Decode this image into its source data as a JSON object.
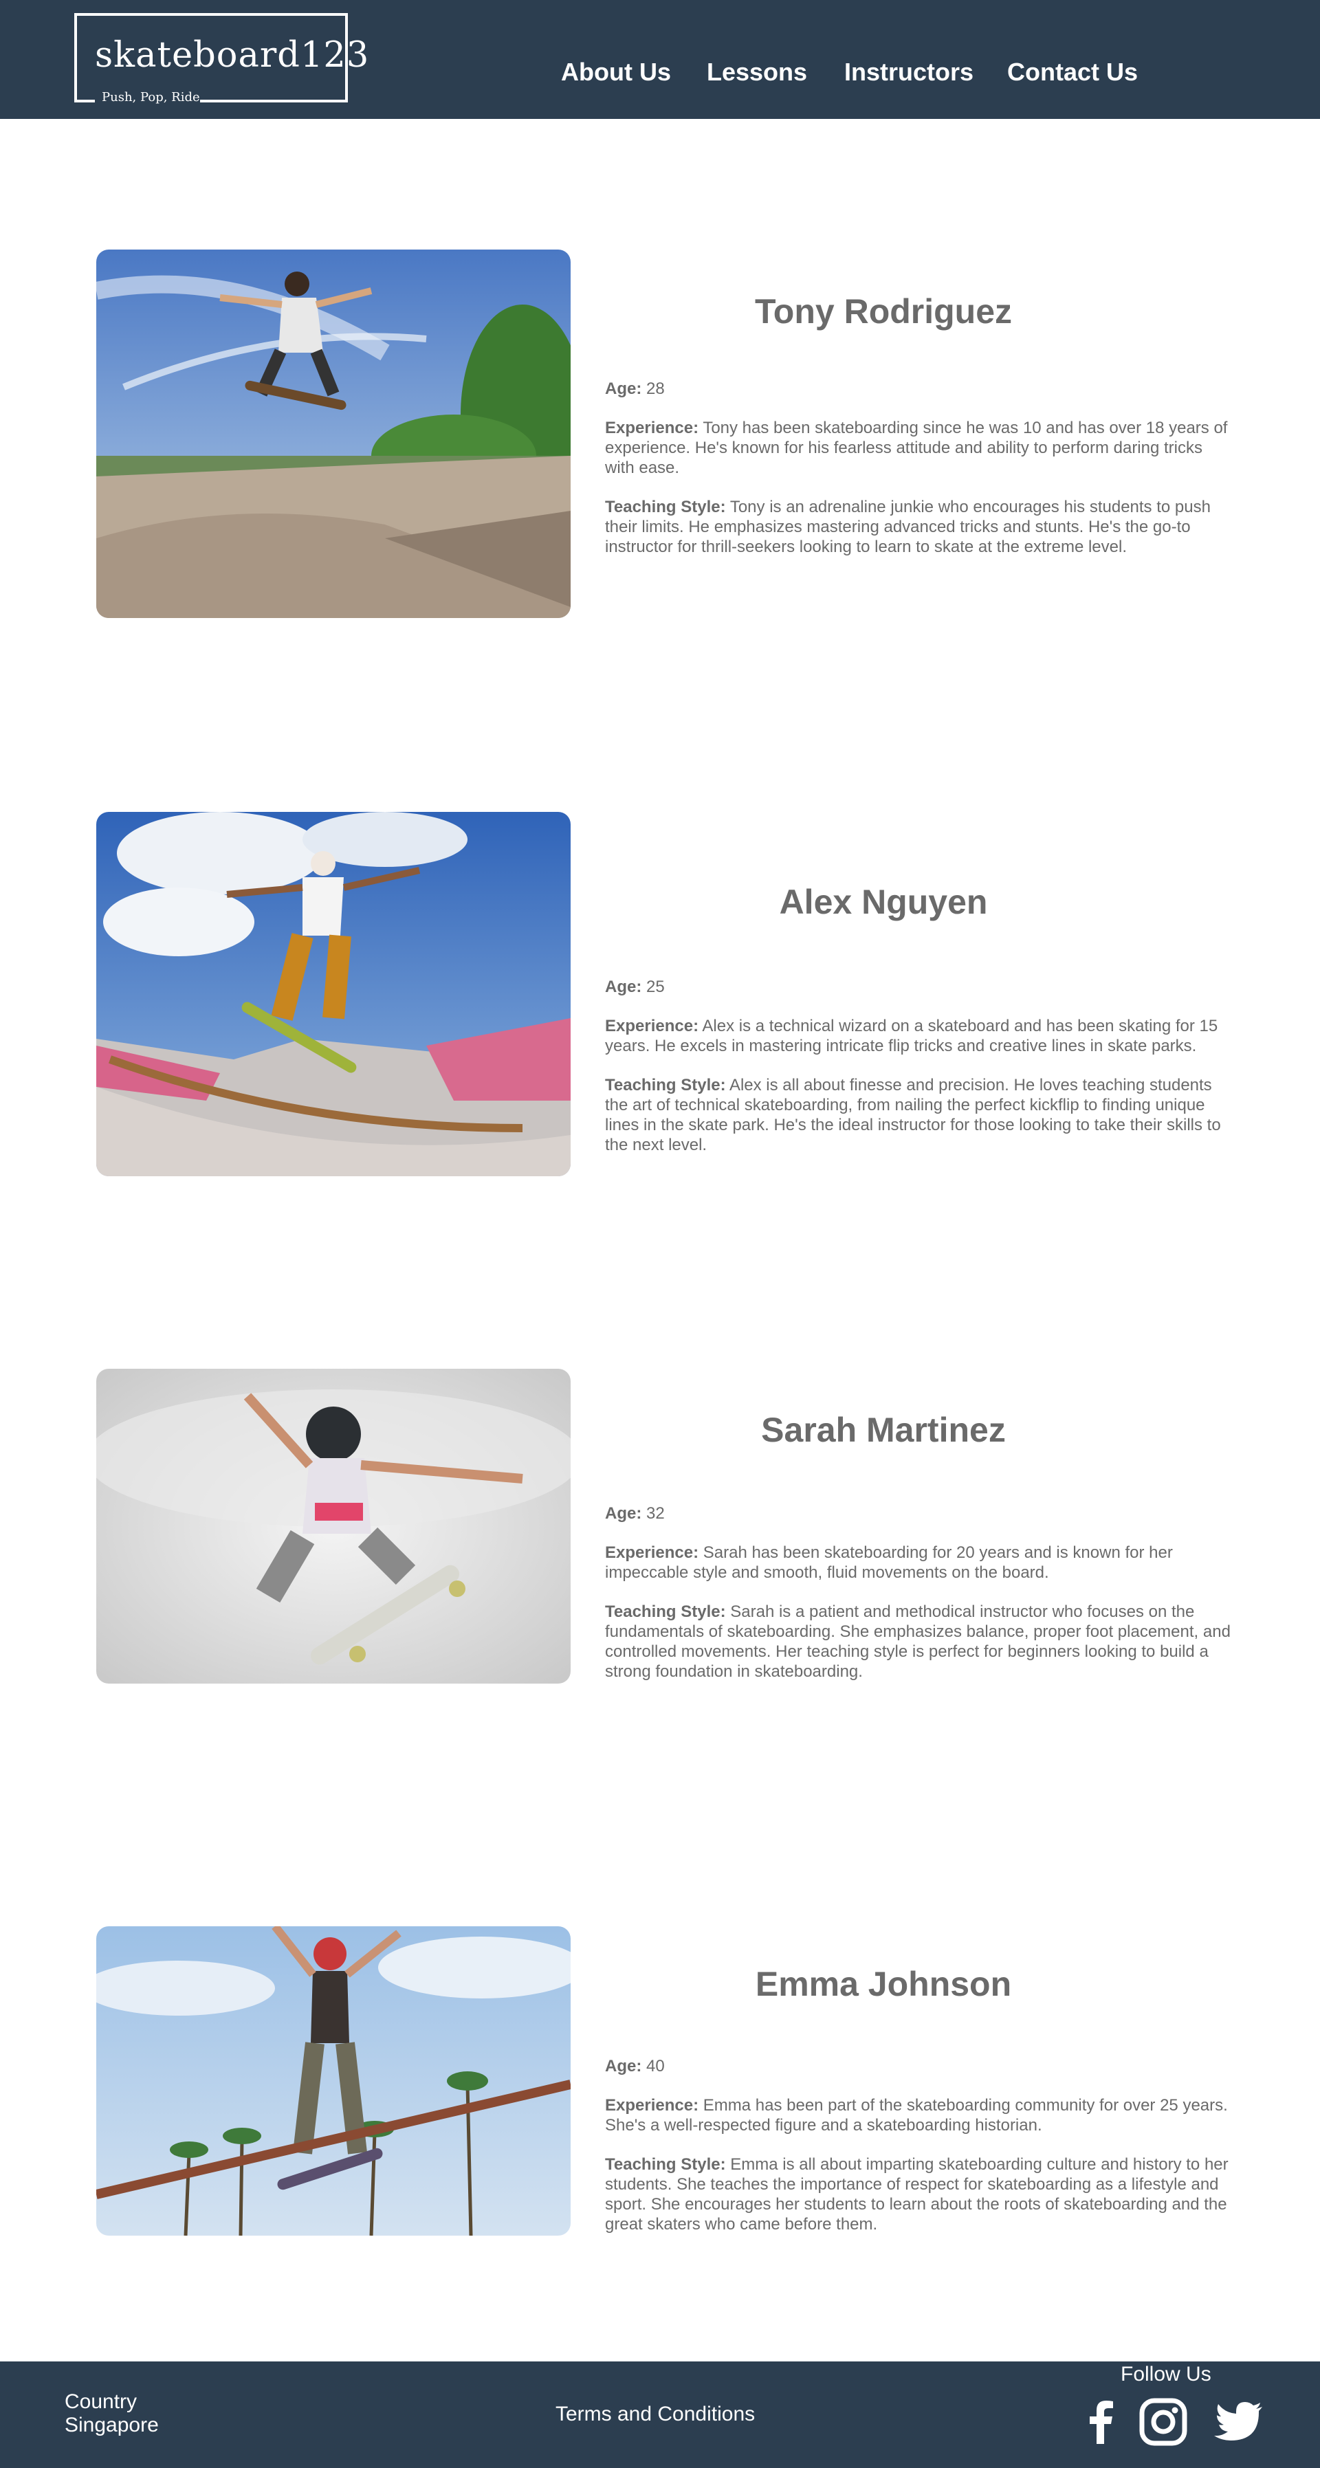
{
  "header": {
    "logo_name": "skateboard123",
    "logo_tagline": "Push, Pop, Ride",
    "nav": [
      "About Us",
      "Lessons",
      "Instructors",
      "Contact Us"
    ]
  },
  "labels": {
    "age": "Age:",
    "experience": "Experience:",
    "teaching_style": "Teaching Style:"
  },
  "instructors": [
    {
      "name": "Tony Rodriguez",
      "age": "28",
      "experience": "Tony has been skateboarding since he was 10 and has over 18 years of experience. He's known for his fearless attitude and ability to perform daring tricks with ease.",
      "teaching_style": "Tony is an adrenaline junkie who encourages his students to push their limits. He emphasizes mastering advanced tricks and stunts. He's the go-to instructor for thrill-seekers looking to learn to skate at the extreme level."
    },
    {
      "name": "Alex Nguyen",
      "age": "25",
      "experience": "Alex is a technical wizard on a skateboard and has been skating for 15 years. He excels in mastering intricate flip tricks and creative lines in skate parks.",
      "teaching_style": "Alex is all about finesse and precision. He loves teaching students the art of technical skateboarding, from nailing the perfect kickflip to finding unique lines in the skate park. He's the ideal instructor for those looking to take their skills to the next level."
    },
    {
      "name": "Sarah Martinez",
      "age": "32",
      "experience": "Sarah has been skateboarding for 20 years and is known for her impeccable style and smooth, fluid movements on the board.",
      "teaching_style": "Sarah is a patient and methodical instructor who focuses on the fundamentals of skateboarding. She emphasizes balance, proper foot placement, and controlled movements. Her teaching style is perfect for beginners looking to build a strong foundation in skateboarding."
    },
    {
      "name": "Emma Johnson",
      "age": "40",
      "experience": "Emma has been part of the skateboarding community for over 25 years. She's a well-respected figure and a skateboarding historian.",
      "teaching_style": "Emma is all about imparting skateboarding culture and history to her students. She teaches the importance of respect for skateboarding as a lifestyle and sport. She encourages her students to learn about the roots of skateboarding and the great skaters who came before them."
    }
  ],
  "footer": {
    "address_line1": "Country",
    "address_line2": "Singapore",
    "terms": "Terms and Conditions",
    "follow": "Follow Us",
    "social": [
      "facebook-icon",
      "instagram-icon",
      "twitter-icon"
    ]
  },
  "colors": {
    "header_bg": "#2c3e50",
    "text_gray": "#6a6a6a",
    "white": "#ffffff"
  }
}
